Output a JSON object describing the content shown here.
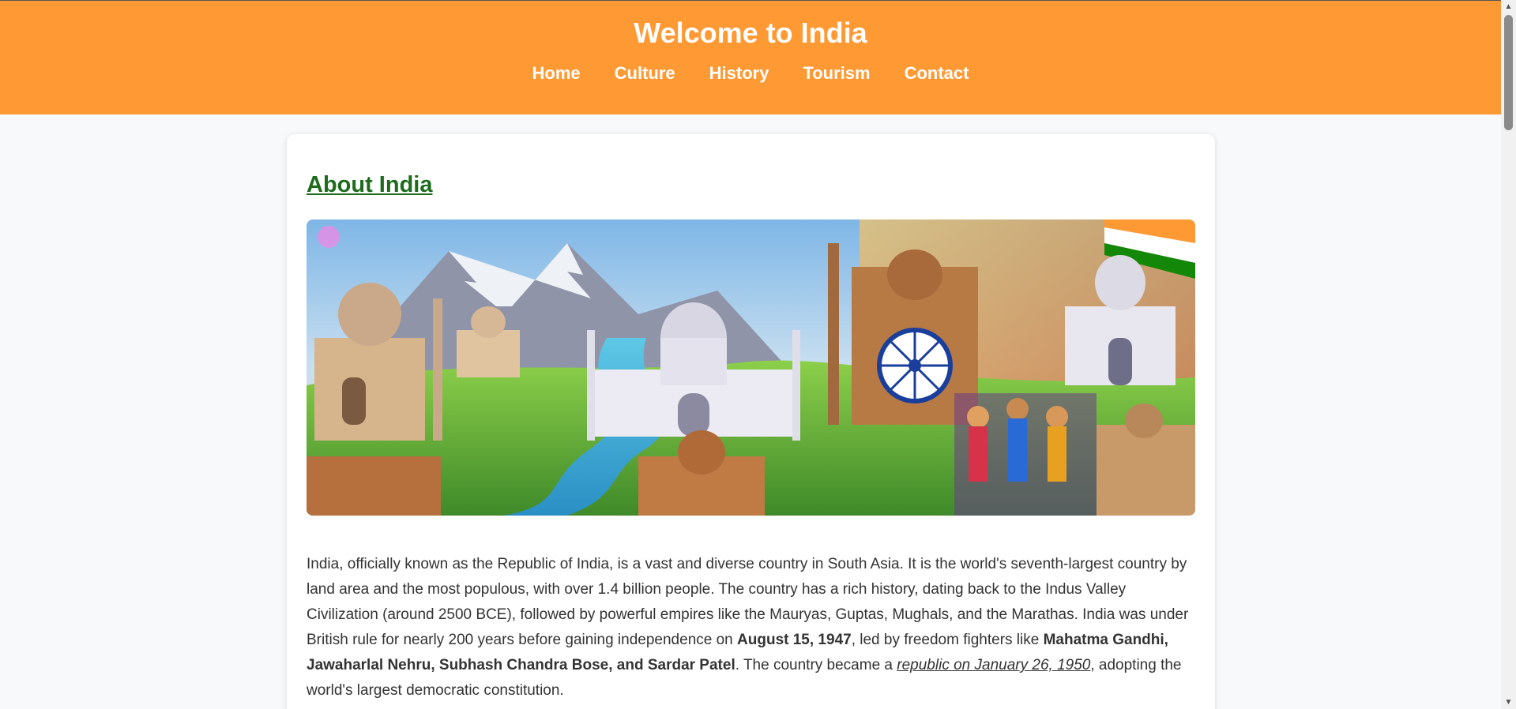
{
  "header": {
    "title": "Welcome to India",
    "nav": [
      "Home",
      "Culture",
      "History",
      "Tourism",
      "Contact"
    ]
  },
  "main": {
    "heading": "About India",
    "hero_image": "collage-of-indian-landmarks",
    "paragraph": {
      "t1": "India, officially known as the Republic of India, is a vast and diverse country in South Asia. It is the world's seventh-largest country by land area and the most populous, with over 1.4 billion people. The country has a rich history, dating back to the Indus Valley Civilization (around 2500 BCE), followed by powerful empires like the Mauryas, Guptas, Mughals, and the Marathas. India was under British rule for nearly 200 years before gaining independence on ",
      "b1": "August 15, 1947",
      "t2": ", led by freedom fighters like ",
      "b2": "Mahatma Gandhi, Jawaharlal Nehru, Subhash Chandra Bose, and Sardar Patel",
      "t3": ". The country became a ",
      "i1": "republic on January 26, 1950",
      "t4": ", adopting the world's largest democratic constitution."
    }
  },
  "colors": {
    "header_bg": "#ff9933",
    "heading": "#1d6b1d",
    "page_bg": "#f7f9fb"
  }
}
